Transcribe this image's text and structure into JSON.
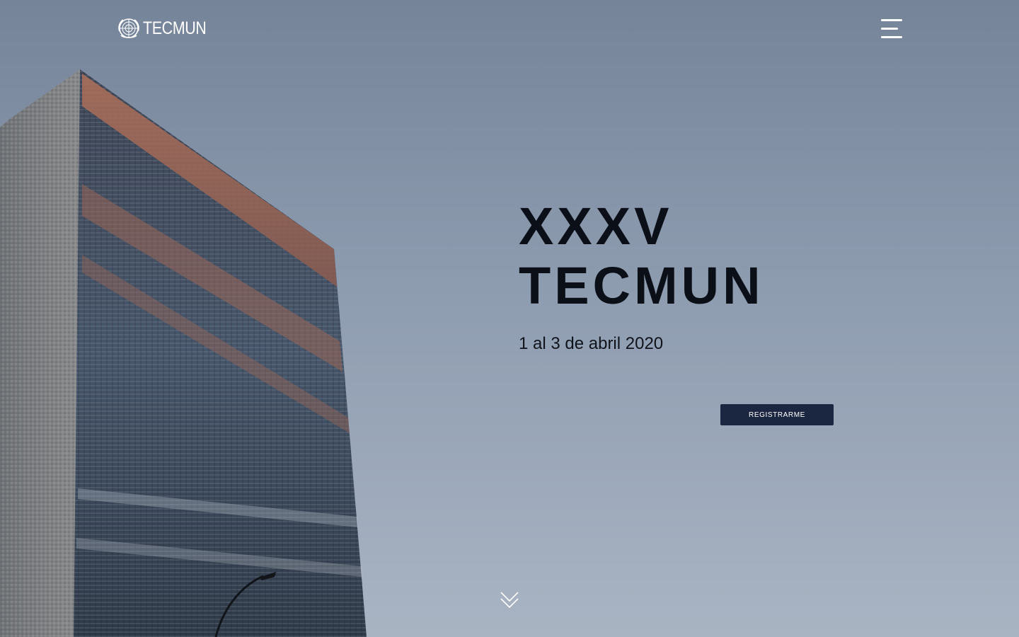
{
  "header": {
    "logo_text": "TECMUN",
    "logo_icon": "un-emblem-icon",
    "menu_icon": "hamburger-menu-icon"
  },
  "hero": {
    "title_line1": "XXXV",
    "title_line2": "TECMUN",
    "date": "1 al 3 de abril 2020",
    "register_label": "REGISTRARME",
    "scroll_icon": "double-chevron-down-icon",
    "background_image": "un-headquarters-building-photo"
  },
  "colors": {
    "button_bg": "#1b2741",
    "title_text": "#0b0f17",
    "sky_top": "#7a8aa0",
    "sky_bottom": "#aab5c4"
  }
}
